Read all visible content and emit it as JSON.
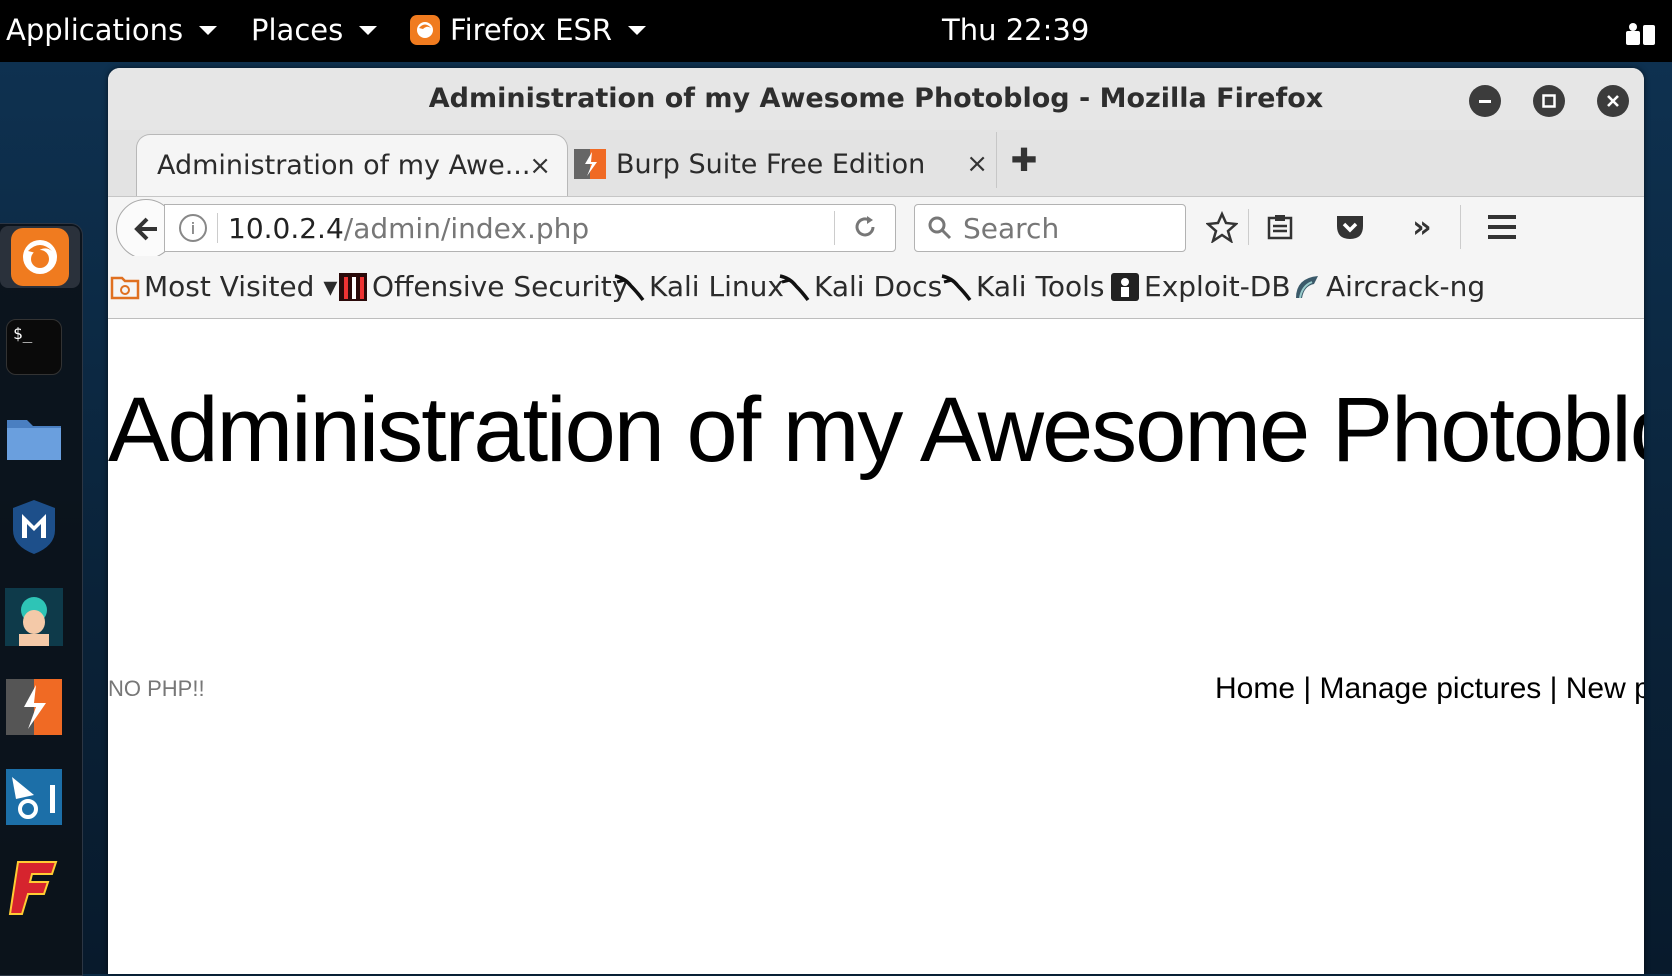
{
  "topbar": {
    "applications": "Applications",
    "places": "Places",
    "browser": "Firefox ESR",
    "clock": "Thu 22:39"
  },
  "window": {
    "title": "Administration of my Awesome Photoblog - Mozilla Firefox"
  },
  "tabs": [
    {
      "label": "Administration of my Awe...",
      "close": "×"
    },
    {
      "label": "Burp Suite Free Edition",
      "close": "×"
    }
  ],
  "urlbar": {
    "host": "10.0.2.4",
    "path": "/admin/index.php"
  },
  "search": {
    "placeholder": "Search"
  },
  "bookmarks": [
    {
      "label": "Most Visited ▾",
      "icon": "folder-icon"
    },
    {
      "label": "Offensive Security",
      "icon": "offsec-icon"
    },
    {
      "label": "Kali Linux",
      "icon": "kali-icon"
    },
    {
      "label": "Kali Docs",
      "icon": "kali-icon"
    },
    {
      "label": "Kali Tools",
      "icon": "kali-icon"
    },
    {
      "label": "Exploit-DB",
      "icon": "exploitdb-icon"
    },
    {
      "label": "Aircrack-ng",
      "icon": "aircrack-icon"
    }
  ],
  "page": {
    "heading": "Administration of my Awesome Photoblog",
    "notice": "NO PHP!!",
    "nav": [
      "Home",
      "Manage pictures",
      "New picture"
    ],
    "nav_sep": " | "
  },
  "colors": {
    "firefox_orange": "#f07b1f",
    "burp_orange": "#f06a24",
    "panel_black": "#000000"
  }
}
